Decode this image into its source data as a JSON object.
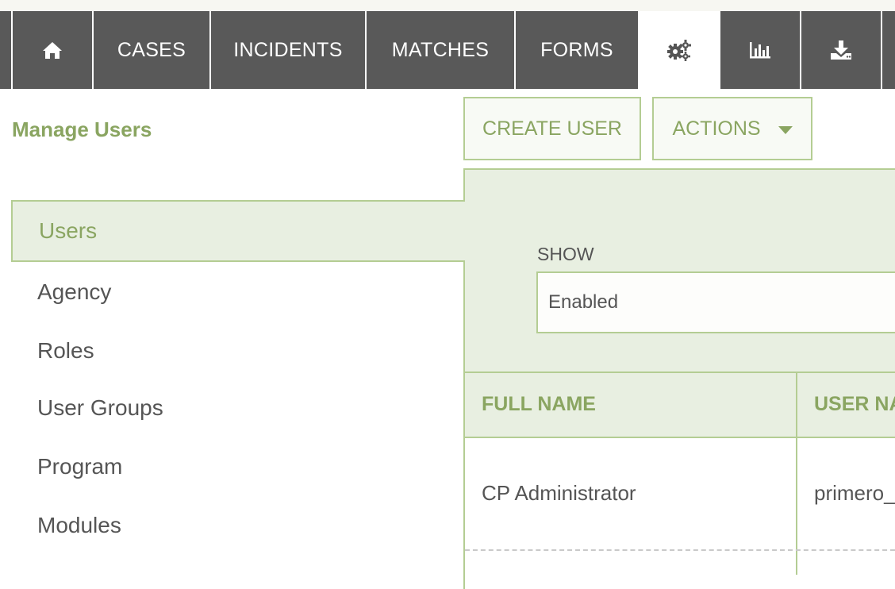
{
  "nav": {
    "home_icon": "home-icon",
    "cases": "CASES",
    "incidents": "INCIDENTS",
    "matches": "MATCHES",
    "forms": "FORMS",
    "settings_icon": "gears-icon",
    "reports_icon": "bar-chart-icon",
    "export_icon": "download-icon"
  },
  "page": {
    "title": "Manage Users"
  },
  "toolbar": {
    "create_user": "CREATE USER",
    "actions": "ACTIONS"
  },
  "sidebar": {
    "items": [
      {
        "label": "Users",
        "active": true
      },
      {
        "label": "Agency"
      },
      {
        "label": "Roles"
      },
      {
        "label": "User Groups"
      },
      {
        "label": "Program"
      },
      {
        "label": "Modules"
      }
    ]
  },
  "filter": {
    "show_label": "SHOW",
    "show_value": "Enabled"
  },
  "table": {
    "columns": [
      "FULL NAME",
      "USER NA"
    ],
    "rows": [
      [
        "CP Administrator",
        "primero_"
      ]
    ]
  },
  "colors": {
    "nav_bg": "#595959",
    "accent": "#8aa561",
    "accent_border": "#b4cd93",
    "panel_bg": "#e8efe1",
    "text": "#555555"
  }
}
